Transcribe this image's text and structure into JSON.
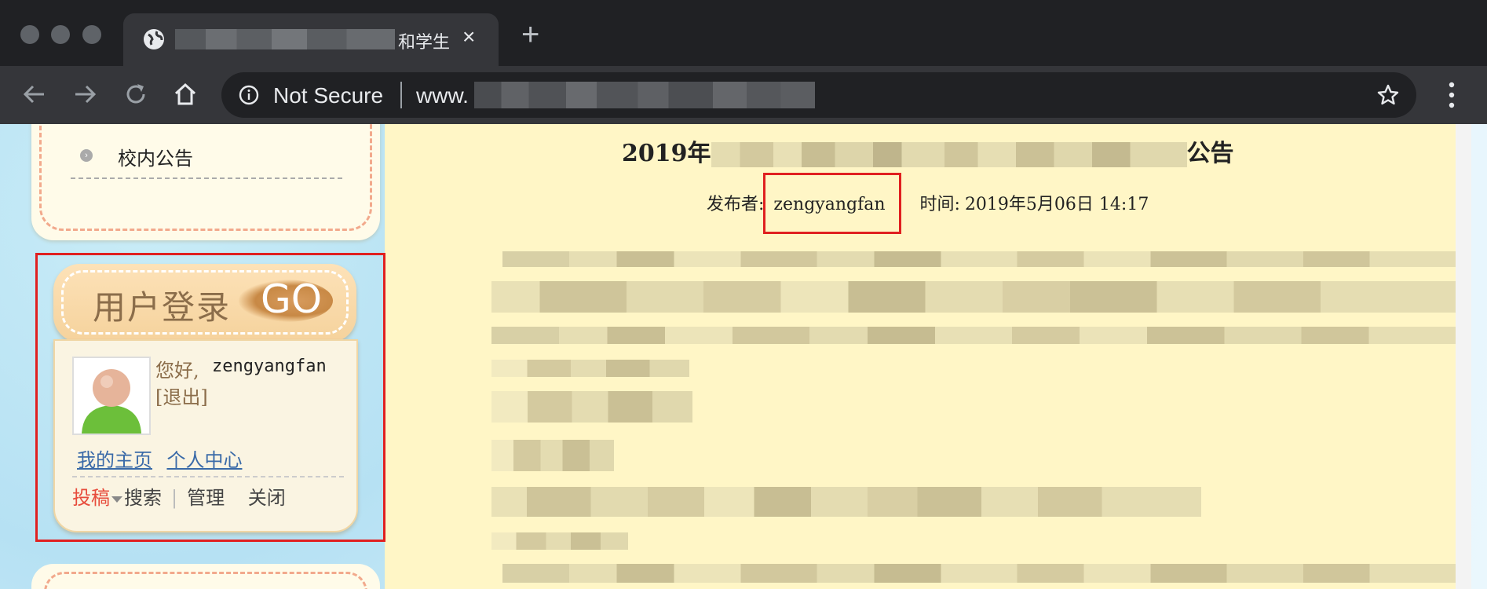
{
  "browser": {
    "tab": {
      "title_visible": "和学生",
      "close": "×"
    },
    "new_tab": "+",
    "omnibox": {
      "security_label": "Not Secure",
      "url_prefix": "www."
    }
  },
  "sidebar": {
    "notice_link": "校内公告",
    "login": {
      "title": "用户登录",
      "go": "GO",
      "greeting": "您好,",
      "username": "zengyangfan",
      "logout": "[退出]",
      "links": [
        "我的主页",
        "个人中心"
      ],
      "actions": {
        "submit": "投稿",
        "search": "搜索",
        "manage": "管理",
        "close": "关闭",
        "separator": "|"
      }
    }
  },
  "article": {
    "title_prefix": "2019年",
    "title_suffix": "公告",
    "publisher_label": "发布者:",
    "publisher": "zengyangfan",
    "time_label": "时间:",
    "time": "2019年5月06日 14:17"
  },
  "colors": {
    "chrome_dark": "#202124",
    "chrome_toolbar": "#35363a",
    "article_bg": "#fff6c6",
    "annotation_red": "#e02020",
    "link_blue": "#3a6aa8",
    "submit_red": "#e74c3c"
  }
}
